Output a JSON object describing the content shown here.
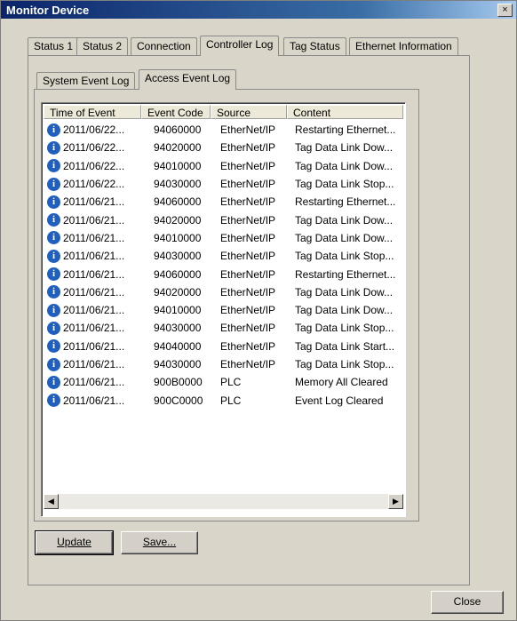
{
  "window": {
    "title": "Monitor Device",
    "close_glyph": "×"
  },
  "tabs": [
    "Status 1",
    "Status 2",
    "Connection",
    "Controller Log",
    "Tag Status",
    "Ethernet Information"
  ],
  "active_tab": "Controller Log",
  "subtabs": [
    "System Event Log",
    "Access Event Log"
  ],
  "active_subtab": "Access Event Log",
  "table": {
    "columns": [
      "Time of Event",
      "Event Code",
      "Source",
      "Content"
    ],
    "rows": [
      [
        "2011/06/22...",
        "94060000",
        "EtherNet/IP",
        "Restarting Ethernet..."
      ],
      [
        "2011/06/22...",
        "94020000",
        "EtherNet/IP",
        "Tag Data Link Dow..."
      ],
      [
        "2011/06/22...",
        "94010000",
        "EtherNet/IP",
        "Tag Data Link Dow..."
      ],
      [
        "2011/06/22...",
        "94030000",
        "EtherNet/IP",
        "Tag Data Link Stop..."
      ],
      [
        "2011/06/21...",
        "94060000",
        "EtherNet/IP",
        "Restarting Ethernet..."
      ],
      [
        "2011/06/21...",
        "94020000",
        "EtherNet/IP",
        "Tag Data Link Dow..."
      ],
      [
        "2011/06/21...",
        "94010000",
        "EtherNet/IP",
        "Tag Data Link Dow..."
      ],
      [
        "2011/06/21...",
        "94030000",
        "EtherNet/IP",
        "Tag Data Link Stop..."
      ],
      [
        "2011/06/21...",
        "94060000",
        "EtherNet/IP",
        "Restarting Ethernet..."
      ],
      [
        "2011/06/21...",
        "94020000",
        "EtherNet/IP",
        "Tag Data Link Dow..."
      ],
      [
        "2011/06/21...",
        "94010000",
        "EtherNet/IP",
        "Tag Data Link Dow..."
      ],
      [
        "2011/06/21...",
        "94030000",
        "EtherNet/IP",
        "Tag Data Link Stop..."
      ],
      [
        "2011/06/21...",
        "94040000",
        "EtherNet/IP",
        "Tag Data Link Start..."
      ],
      [
        "2011/06/21...",
        "94030000",
        "EtherNet/IP",
        "Tag Data Link Stop..."
      ],
      [
        "2011/06/21...",
        "900B0000",
        "PLC",
        "Memory All Cleared"
      ],
      [
        "2011/06/21...",
        "900C0000",
        "PLC",
        "Event Log Cleared"
      ]
    ],
    "row_icon": "info-icon",
    "scroll_left_glyph": "◀",
    "scroll_right_glyph": "▶"
  },
  "buttons": {
    "update": "Update",
    "save": "Save...",
    "close": "Close"
  },
  "colors": {
    "titlebar": "#0a246a",
    "info_icon": "#1f5fbf",
    "dialog_bg": "#d9d5c8"
  }
}
